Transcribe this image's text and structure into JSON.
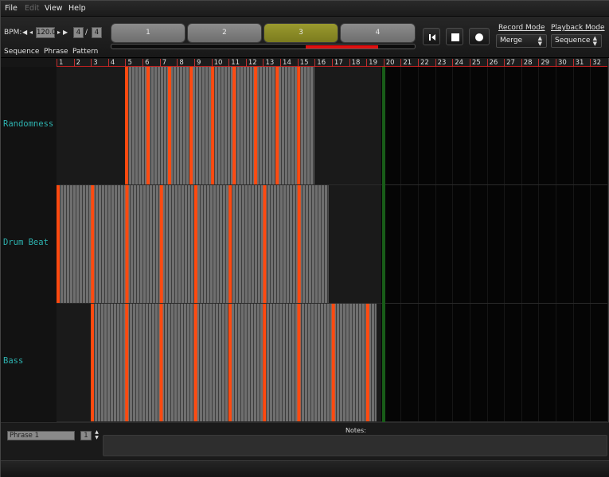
{
  "menu": [
    {
      "label": "File",
      "enabled": true
    },
    {
      "label": "Edit",
      "enabled": false
    },
    {
      "label": "View",
      "enabled": true
    },
    {
      "label": "Help",
      "enabled": true
    }
  ],
  "transport": {
    "bpm_label": "BPM:",
    "bpm_value": "120.0",
    "time_sig_num": "4",
    "time_sig_sep": "/",
    "time_sig_den": "4"
  },
  "mode_tabs": [
    "Sequence",
    "Phrase",
    "Pattern"
  ],
  "phrases": [
    {
      "label": "1",
      "active": false
    },
    {
      "label": "2",
      "active": false
    },
    {
      "label": "3",
      "active": true
    },
    {
      "label": "4",
      "active": false
    }
  ],
  "phrase_progress": {
    "start": 0.64,
    "end": 0.88,
    "color": "#e01010"
  },
  "buttons": {
    "rewind_icon": "skip-to-start-icon",
    "stop_icon": "stop-icon",
    "record_icon": "record-icon"
  },
  "record_mode": {
    "label": "Record Mode",
    "value": "Merge"
  },
  "playback_mode": {
    "label": "Playback Mode",
    "value": "Sequence"
  },
  "ruler": [
    "1",
    "2",
    "3",
    "4",
    "5",
    "6",
    "7",
    "8",
    "9",
    "10",
    "11",
    "12",
    "13",
    "14",
    "15",
    "16",
    "17",
    "18",
    "19",
    "20",
    "21",
    "22",
    "23",
    "24",
    "25",
    "26",
    "27",
    "28",
    "29",
    "30",
    "31",
    "32"
  ],
  "tracks": [
    {
      "name": "Randomness",
      "pattern_start_bar": 5,
      "pattern_end_bar": 16,
      "bar_len_in_bars": 1.25
    },
    {
      "name": "Drum Beat",
      "pattern_start_bar": 1,
      "pattern_end_bar": 16.8,
      "bar_len_in_bars": 2
    },
    {
      "name": "Bass",
      "pattern_start_bar": 3,
      "pattern_end_bar": 19.6,
      "bar_len_in_bars": 2
    }
  ],
  "playhead_bar": 19.9,
  "colors": {
    "accent": "#ff4a10",
    "region": "#6f6f6f",
    "track_label": "#2db3b0",
    "playhead": "#185c18"
  },
  "bottom": {
    "phrase_name": "Phrase 1",
    "phrase_number": "1",
    "notes_label": "Notes:",
    "notes_value": ""
  }
}
